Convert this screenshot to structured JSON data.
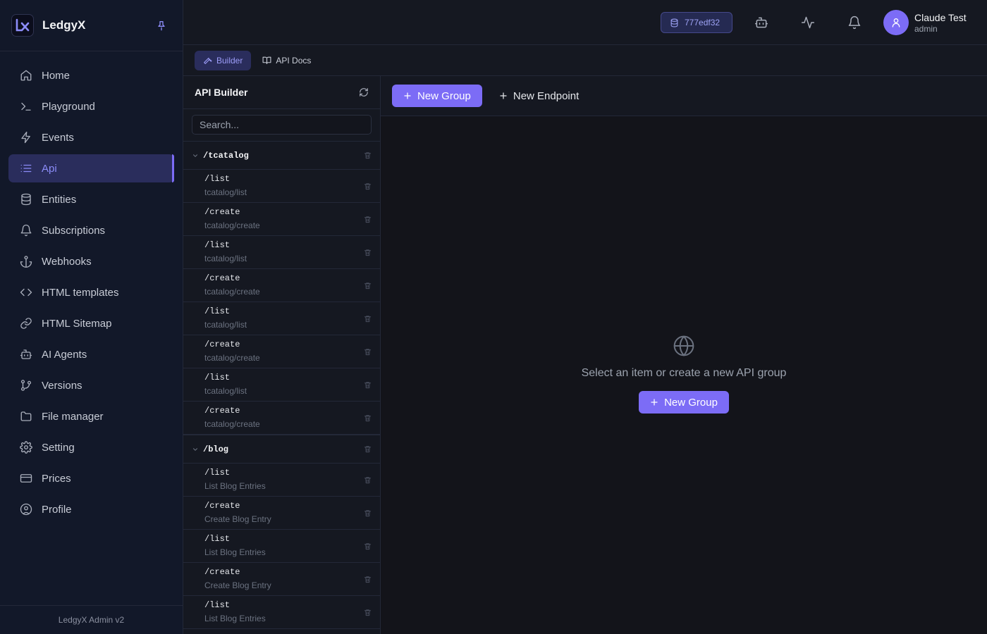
{
  "brand": {
    "name": "LedgyX"
  },
  "nav": [
    {
      "label": "Home",
      "icon": "home-icon"
    },
    {
      "label": "Playground",
      "icon": "terminal-icon"
    },
    {
      "label": "Events",
      "icon": "bolt-icon"
    },
    {
      "label": "Api",
      "icon": "list-icon",
      "active": true
    },
    {
      "label": "Entities",
      "icon": "database-icon"
    },
    {
      "label": "Subscriptions",
      "icon": "bell-icon"
    },
    {
      "label": "Webhooks",
      "icon": "anchor-icon"
    },
    {
      "label": "HTML templates",
      "icon": "code-icon"
    },
    {
      "label": "HTML Sitemap",
      "icon": "link-icon"
    },
    {
      "label": "AI Agents",
      "icon": "bot-icon"
    },
    {
      "label": "Versions",
      "icon": "branch-icon"
    },
    {
      "label": "File manager",
      "icon": "folder-icon"
    },
    {
      "label": "Setting",
      "icon": "gear-icon"
    },
    {
      "label": "Prices",
      "icon": "card-icon"
    },
    {
      "label": "Profile",
      "icon": "user-circle-icon"
    }
  ],
  "footer": {
    "version_text": "LedgyX Admin v2"
  },
  "header": {
    "hash": "777edf32",
    "user_name": "Claude Test",
    "user_role": "admin"
  },
  "tabs": [
    {
      "label": "Builder",
      "active": true
    },
    {
      "label": "API Docs"
    }
  ],
  "panel": {
    "title": "API Builder",
    "search_placeholder": "Search...",
    "groups": [
      {
        "name": "/tcatalog",
        "endpoints": [
          {
            "path": "/list",
            "sub": "tcatalog/list"
          },
          {
            "path": "/create",
            "sub": "tcatalog/create"
          },
          {
            "path": "/list",
            "sub": "tcatalog/list"
          },
          {
            "path": "/create",
            "sub": "tcatalog/create"
          },
          {
            "path": "/list",
            "sub": "tcatalog/list"
          },
          {
            "path": "/create",
            "sub": "tcatalog/create"
          },
          {
            "path": "/list",
            "sub": "tcatalog/list"
          },
          {
            "path": "/create",
            "sub": "tcatalog/create"
          }
        ]
      },
      {
        "name": "/blog",
        "endpoints": [
          {
            "path": "/list",
            "sub": "List Blog Entries"
          },
          {
            "path": "/create",
            "sub": "Create Blog Entry"
          },
          {
            "path": "/list",
            "sub": "List Blog Entries"
          },
          {
            "path": "/create",
            "sub": "Create Blog Entry"
          },
          {
            "path": "/list",
            "sub": "List Blog Entries"
          }
        ]
      }
    ]
  },
  "toolbar": {
    "new_group_label": "New Group",
    "new_endpoint_label": "New Endpoint"
  },
  "empty_state": {
    "message": "Select an item or create a new API group",
    "button_label": "New Group"
  },
  "colors": {
    "accent": "#7c6cf6",
    "active_nav_bg": "#2a2d5c",
    "sidebar_bg": "#121829"
  }
}
